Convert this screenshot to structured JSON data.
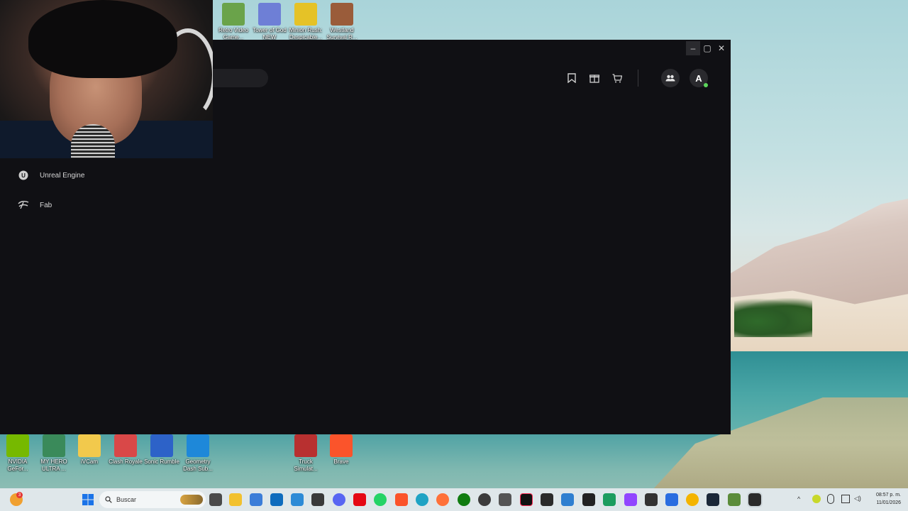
{
  "desktop": {
    "top_icons": [
      {
        "label": "Retro Video Game...",
        "color": "#6aa34a"
      },
      {
        "label": "Tower of God NEW WORLD",
        "color": "#6e7fd6"
      },
      {
        "label": "Minion Rush: Despicable...",
        "color": "#e5c227"
      },
      {
        "label": "Westland Survival R...",
        "color": "#9a5c3a"
      }
    ],
    "bottom_icons": [
      {
        "label": "NVIDIA GeFor...",
        "color": "#76b900"
      },
      {
        "label": "MY HERO ULTRA ...",
        "color": "#3a8a5a"
      },
      {
        "label": "iVCam",
        "color": "#f2c94c"
      },
      {
        "label": "Clash Royale",
        "color": "#d94848"
      },
      {
        "label": "Sonic Rumble",
        "color": "#2d62c8"
      },
      {
        "label": "Geometry Dash Sub...",
        "color": "#1e88d9"
      },
      {
        "label": "Truck Simulat...",
        "color": "#b83030"
      },
      {
        "label": "Brave",
        "color": "#fb542b"
      }
    ]
  },
  "launcher": {
    "window_controls": {
      "minimize": "–",
      "maximize": "▢",
      "close": "✕"
    },
    "nav": [
      {
        "label": "Unreal Engine",
        "icon": "unreal-engine-icon"
      },
      {
        "label": "Fab",
        "icon": "fab-icon"
      }
    ],
    "toolbar_icons": [
      "bookmark-icon",
      "gift-icon",
      "cart-icon"
    ],
    "avatar_letter": "A"
  },
  "taskbar": {
    "search_placeholder": "Buscar",
    "notification_badge": "3",
    "time": "08:57 p. m.",
    "date": "11/01/2026",
    "apps": [
      "task-view",
      "file-explorer",
      "store",
      "outlook",
      "widgets",
      "sandbox",
      "discord",
      "netflix",
      "whatsapp",
      "brave",
      "edge",
      "firefox",
      "xbox",
      "obs",
      "tf",
      "tiktok",
      "epic",
      "photos",
      "camera",
      "bank",
      "twitch",
      "nvidia",
      "app-blue",
      "chrome",
      "steam",
      "minecraft",
      "epic-active"
    ]
  }
}
